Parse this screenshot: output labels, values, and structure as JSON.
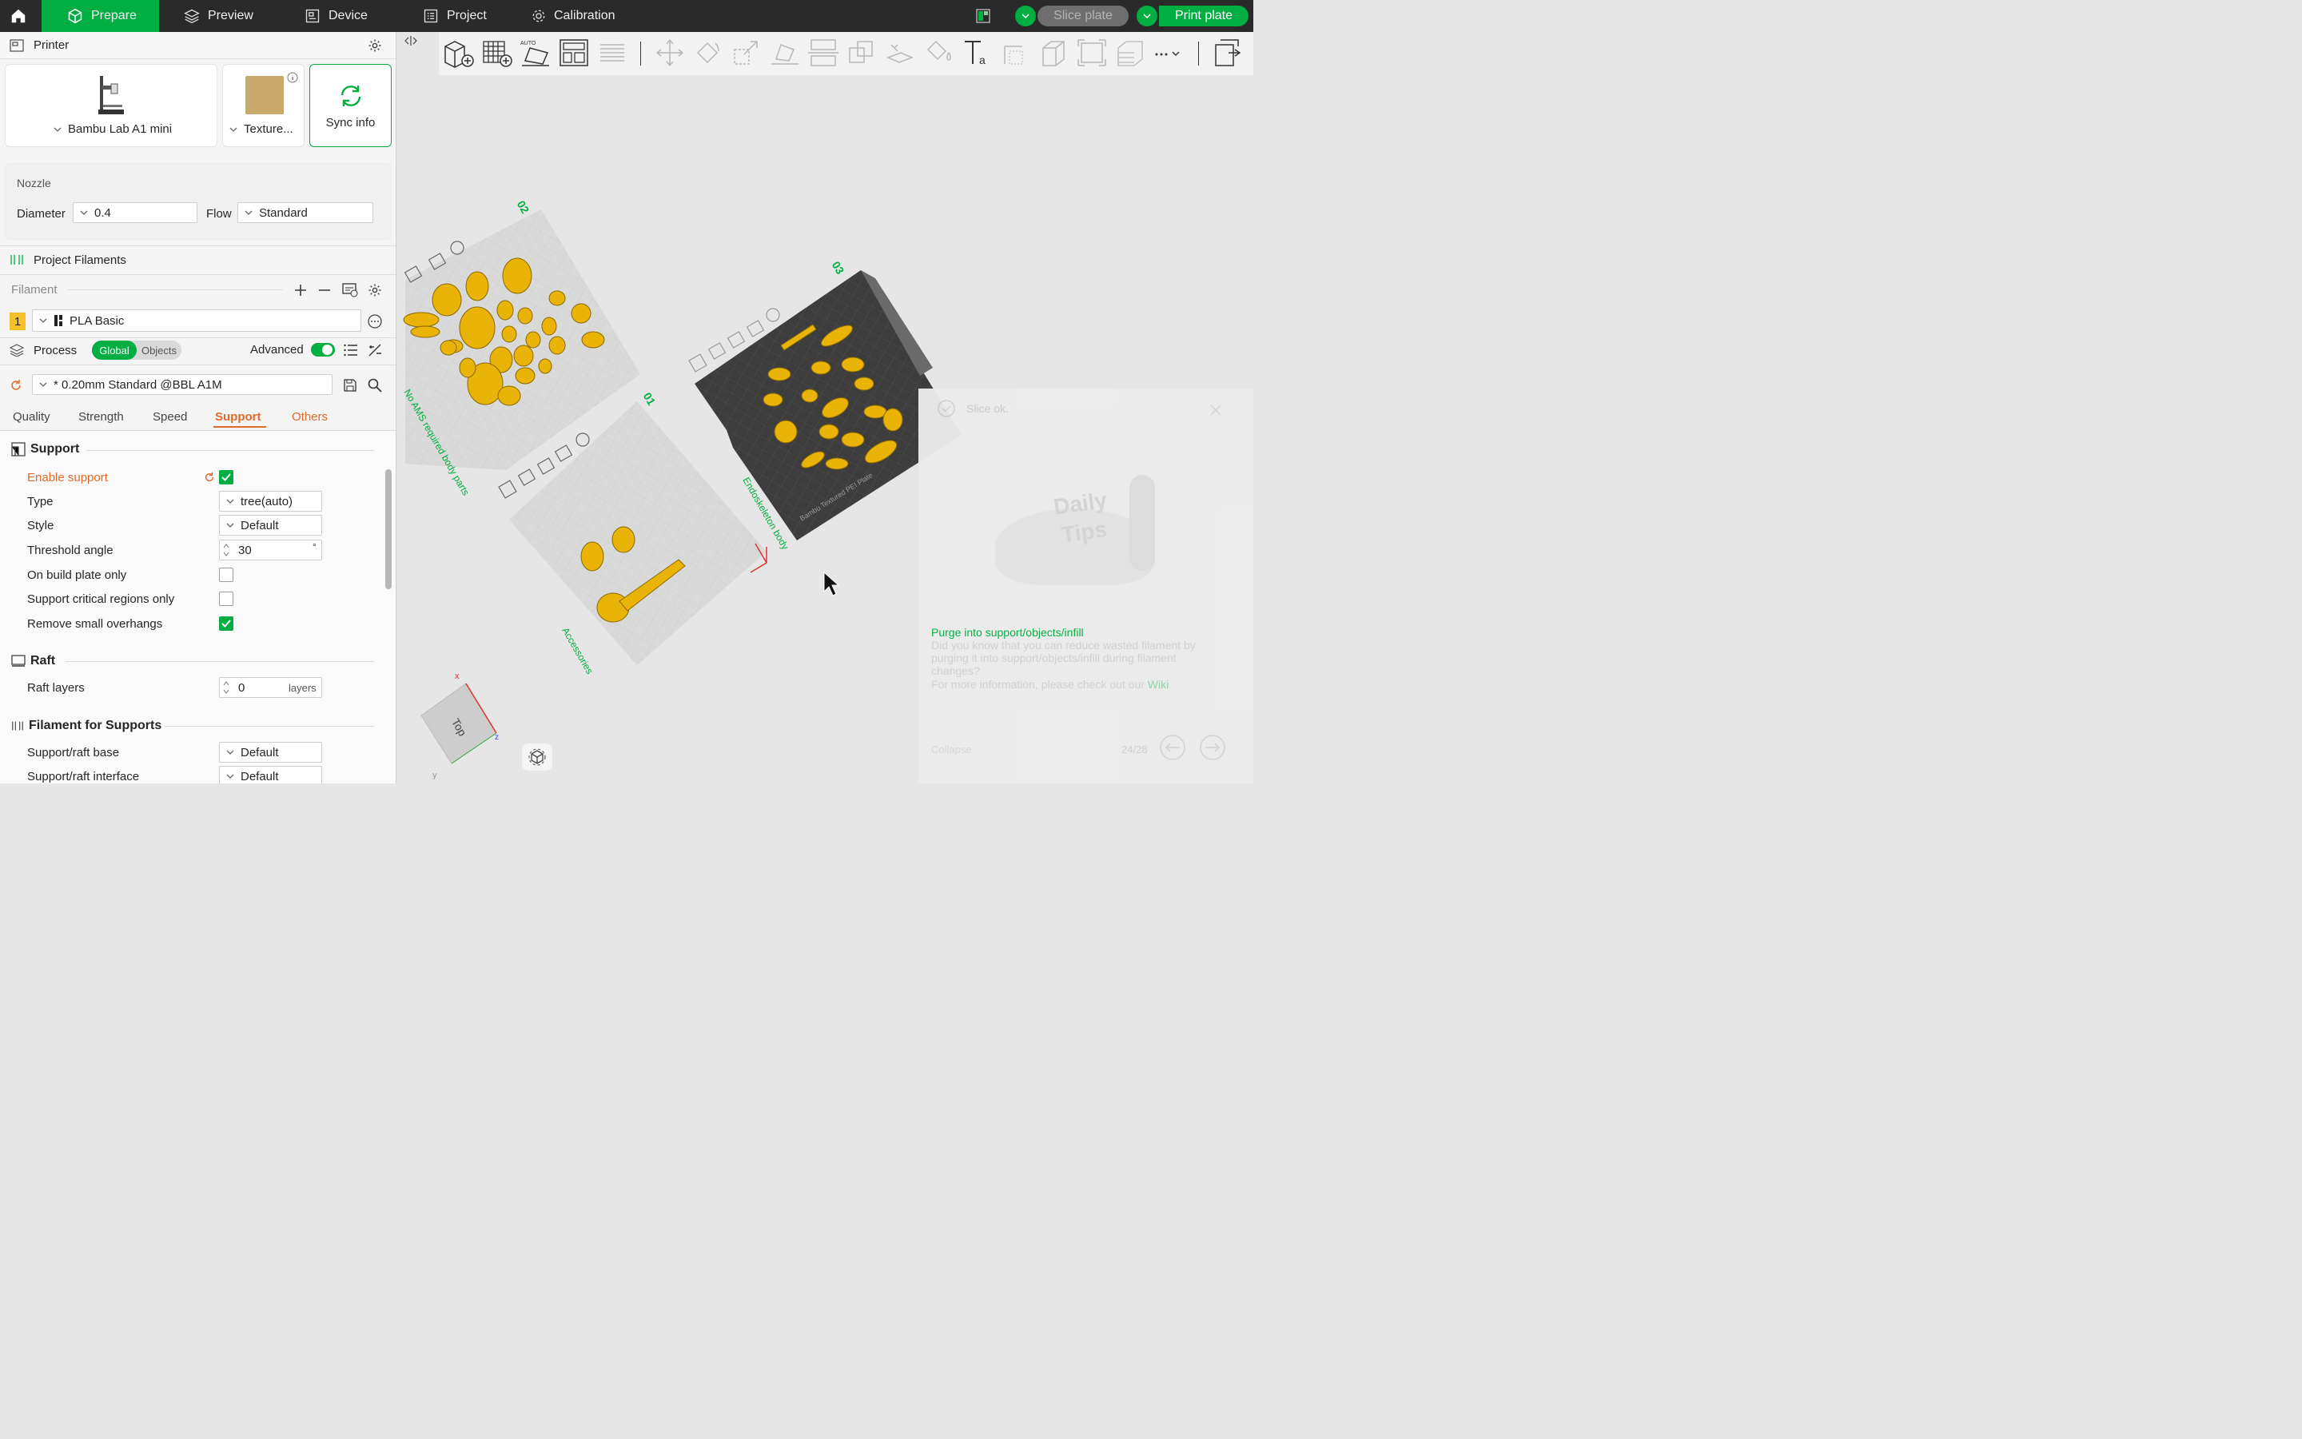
{
  "topbar": {
    "tabs": [
      {
        "label": "Prepare",
        "icon": "cube-icon",
        "active": true
      },
      {
        "label": "Preview",
        "icon": "layers-icon",
        "active": false
      },
      {
        "label": "Device",
        "icon": "device-icon",
        "active": false
      },
      {
        "label": "Project",
        "icon": "project-icon",
        "active": false
      },
      {
        "label": "Calibration",
        "icon": "calibration-icon",
        "active": false
      }
    ],
    "slice_label": "Slice plate",
    "print_label": "Print plate",
    "accent": "#00ae42"
  },
  "printer": {
    "section_title": "Printer",
    "printer_name": "Bambu Lab A1 mini",
    "plate_name": "Texture...",
    "sync_label": "Sync info",
    "nozzle_title": "Nozzle",
    "diameter_label": "Diameter",
    "diameter_value": "0.4",
    "flow_label": "Flow",
    "flow_value": "Standard"
  },
  "filaments": {
    "section_title": "Project Filaments",
    "column_label": "Filament",
    "items": [
      {
        "index": "1",
        "name": "PLA Basic",
        "color": "#f5c02a"
      }
    ]
  },
  "process": {
    "section_title": "Process",
    "toggle_global": "Global",
    "toggle_objects": "Objects",
    "advanced_label": "Advanced",
    "advanced_on": true,
    "preset": "* 0.20mm Standard @BBL A1M",
    "tabs": [
      "Quality",
      "Strength",
      "Speed",
      "Support",
      "Others"
    ],
    "active_tab": "Support"
  },
  "support": {
    "group_title": "Support",
    "enable_support": "Enable support",
    "type_label": "Type",
    "type_value": "tree(auto)",
    "style_label": "Style",
    "style_value": "Default",
    "threshold_label": "Threshold angle",
    "threshold_value": "30",
    "threshold_unit": "°",
    "build_plate_only": "On build plate only",
    "critical_only": "Support critical regions only",
    "remove_small": "Remove small overhangs",
    "raft_title": "Raft",
    "raft_layers_label": "Raft layers",
    "raft_layers_value": "0",
    "raft_layers_unit": "layers",
    "filament_supports_title": "Filament for Supports",
    "base_label": "Support/raft base",
    "base_value": "Default",
    "interface_label": "Support/raft interface",
    "interface_value": "Default"
  },
  "plates": [
    {
      "number": "02",
      "name": ""
    },
    {
      "number": "01",
      "name": "Accessories"
    },
    {
      "number": "03",
      "name": "Endoskeleton body"
    },
    {
      "name": "No AMS required body parts"
    }
  ],
  "plate_texture_label": "Bambu Textured PEI Plate",
  "view_cube": {
    "label": "Top",
    "x": "x",
    "y": "y",
    "z": "z"
  },
  "notification": {
    "text": "Slice ok."
  },
  "tips": {
    "title": "Daily Tips",
    "headline": "Purge into support/objects/infill",
    "body": "Did you know that you can reduce wasted filament by purging it into support/objects/infill during filament changes?",
    "more": "For more information, please check out our",
    "link": "Wiki",
    "collapse": "Collapse",
    "page": "24/28"
  }
}
